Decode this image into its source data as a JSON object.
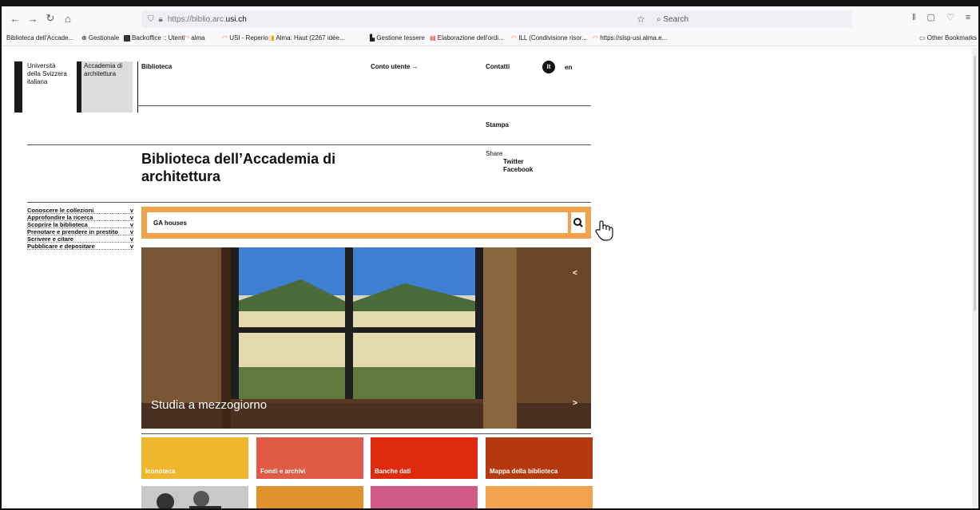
{
  "browser": {
    "url_prefix": "https://biblio.arc.",
    "url_domain": "usi.ch",
    "search_placeholder": "Search",
    "bookmarks": [
      "Biblioteca dell'Accade...",
      "⊕ Gestionale",
      "Backoffice :: Utenti",
      "alma",
      "USI - Reperio",
      "Alma: Haut (2267 idée...",
      "Gestione tessere",
      "Elaborazione dell'ordi...",
      "ILL (Condivisione risor...",
      "https://slsp-usi.alma.e..."
    ],
    "other_bookmarks": "Other Bookmarks"
  },
  "header": {
    "university": "Università della Svizzera italiana",
    "academy": "Accademia di architettura",
    "biblioteca": "Biblioteca",
    "conto": "Conto utente →",
    "contatti": "Contatti",
    "lang_it": "it",
    "lang_en": "en",
    "stampa": "Stampa",
    "share": "Share",
    "twitter": "Twitter",
    "facebook": "Facebook"
  },
  "page_title": "Biblioteca dell’Accademia di architettura",
  "menu": [
    {
      "label": "Conoscere le collezioni",
      "chevron": "v"
    },
    {
      "label": "Approfondire la ricerca",
      "chevron": "v"
    },
    {
      "label": "Scoprire la biblioteca",
      "chevron": "v"
    },
    {
      "label": "Prenotare e prendere in prestito",
      "chevron": "v"
    },
    {
      "label": "Scrivere e citare",
      "chevron": "v"
    },
    {
      "label": "Pubblicare e depositare",
      "chevron": "v"
    }
  ],
  "search": {
    "value": "GA houses"
  },
  "hero": {
    "caption": "Studia a mezzogiorno",
    "prev": "<",
    "next": ">"
  },
  "tiles": [
    {
      "label": "Iconoteca",
      "color": "#f0b62e"
    },
    {
      "label": "Fondi e archivi",
      "color": "#e05a45"
    },
    {
      "label": "Banche dati",
      "color": "#e02a0f"
    },
    {
      "label": "Mappa della biblioteca",
      "color": "#b5390e"
    }
  ],
  "tiles_row2_colors": [
    "#9a9a9a",
    "#e0912e",
    "#d25a88",
    "#f4a24e"
  ]
}
